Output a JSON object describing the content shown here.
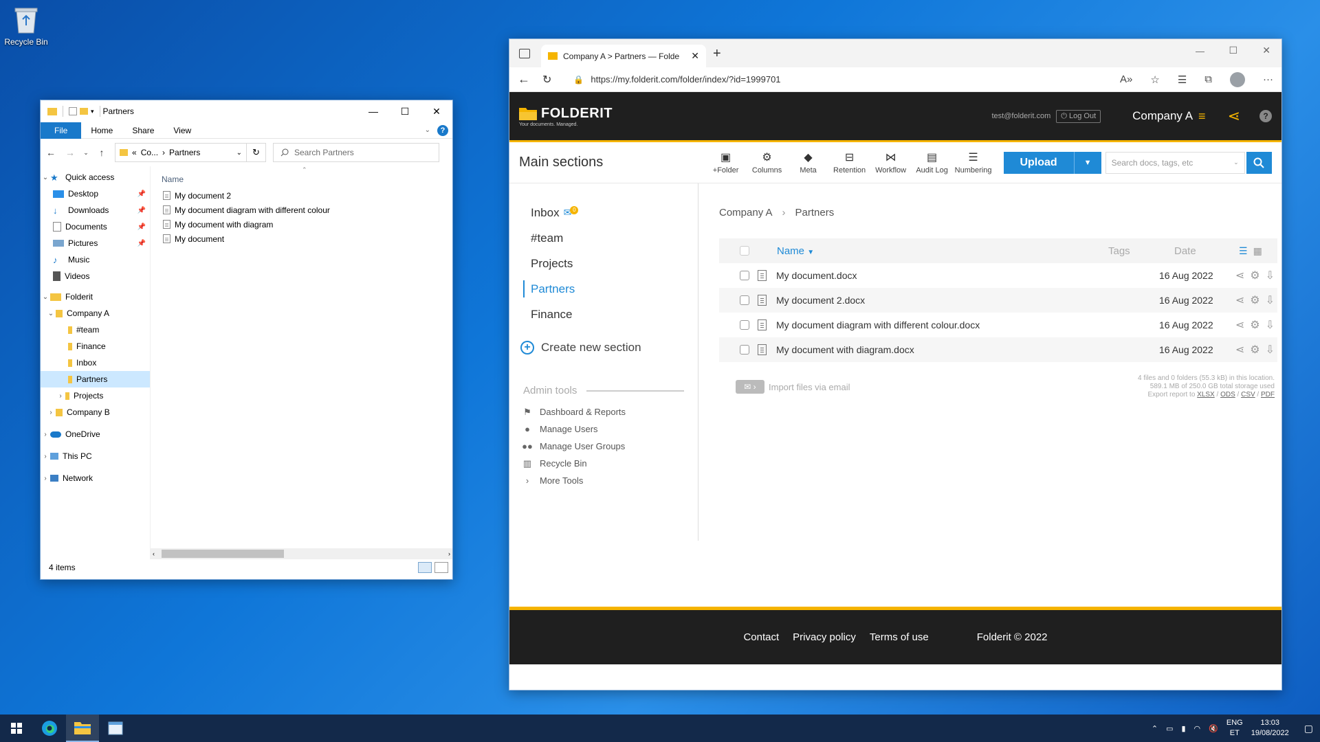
{
  "desktop": {
    "recycle_bin_label": "Recycle Bin"
  },
  "explorer": {
    "title": "Partners",
    "ribbon": {
      "file": "File",
      "home": "Home",
      "share": "Share",
      "view": "View"
    },
    "address": {
      "prefix": "«",
      "crumb1": "Co...",
      "crumb2": "Partners"
    },
    "search_placeholder": "Search Partners",
    "column_name": "Name",
    "nav": {
      "quick_access": "Quick access",
      "desktop": "Desktop",
      "downloads": "Downloads",
      "documents": "Documents",
      "pictures": "Pictures",
      "music": "Music",
      "videos": "Videos",
      "folderit": "Folderit",
      "company_a": "Company A",
      "team": "#team",
      "finance": "Finance",
      "inbox": "Inbox",
      "partners": "Partners",
      "projects": "Projects",
      "company_b": "Company B",
      "onedrive": "OneDrive",
      "this_pc": "This PC",
      "network": "Network"
    },
    "files": [
      "My document 2",
      "My document diagram with different colour",
      "My document with diagram",
      "My document"
    ],
    "status": "4 items"
  },
  "browser": {
    "tab_title": "Company A > Partners — Folder",
    "url": "https://my.folderit.com/folder/index/?id=1999701"
  },
  "folderit": {
    "logo": "FOLDERIT",
    "tagline": "Your documents. Managed.",
    "user_email": "test@folderit.com",
    "logout": "Log Out",
    "company": "Company A",
    "main_sections": "Main sections",
    "tools": [
      "+Folder",
      "Columns",
      "Meta",
      "Retention",
      "Workflow",
      "Audit Log",
      "Numbering"
    ],
    "upload": "Upload",
    "search_placeholder": "Search docs, tags, etc",
    "sections": [
      "Inbox",
      "#team",
      "Projects",
      "Partners",
      "Finance"
    ],
    "inbox_badge": "0",
    "create_section": "Create new section",
    "admin_title": "Admin tools",
    "admin_items": [
      "Dashboard & Reports",
      "Manage Users",
      "Manage User Groups",
      "Recycle Bin",
      "More Tools"
    ],
    "breadcrumb": [
      "Company A",
      "Partners"
    ],
    "table": {
      "col_name": "Name",
      "col_tags": "Tags",
      "col_date": "Date",
      "rows": [
        {
          "name": "My document.docx",
          "date": "16 Aug 2022"
        },
        {
          "name": "My document 2.docx",
          "date": "16 Aug 2022"
        },
        {
          "name": "My document diagram with different colour.docx",
          "date": "16 Aug 2022"
        },
        {
          "name": "My document with diagram.docx",
          "date": "16 Aug 2022"
        }
      ]
    },
    "import_email": "Import files via email",
    "stats_line1": "4 files and 0 folders (55.3 kB) in this location.",
    "stats_line2": "589.1 MB of 250.0 GB total storage used",
    "export_prefix": "Export report to",
    "export_formats": [
      "XLSX",
      "ODS",
      "CSV",
      "PDF"
    ],
    "footer": {
      "contact": "Contact",
      "privacy": "Privacy policy",
      "terms": "Terms of use",
      "copyright": "Folderit © 2022"
    }
  },
  "taskbar": {
    "lang1": "ENG",
    "lang2": "ET",
    "time": "13:03",
    "date": "19/08/2022"
  }
}
